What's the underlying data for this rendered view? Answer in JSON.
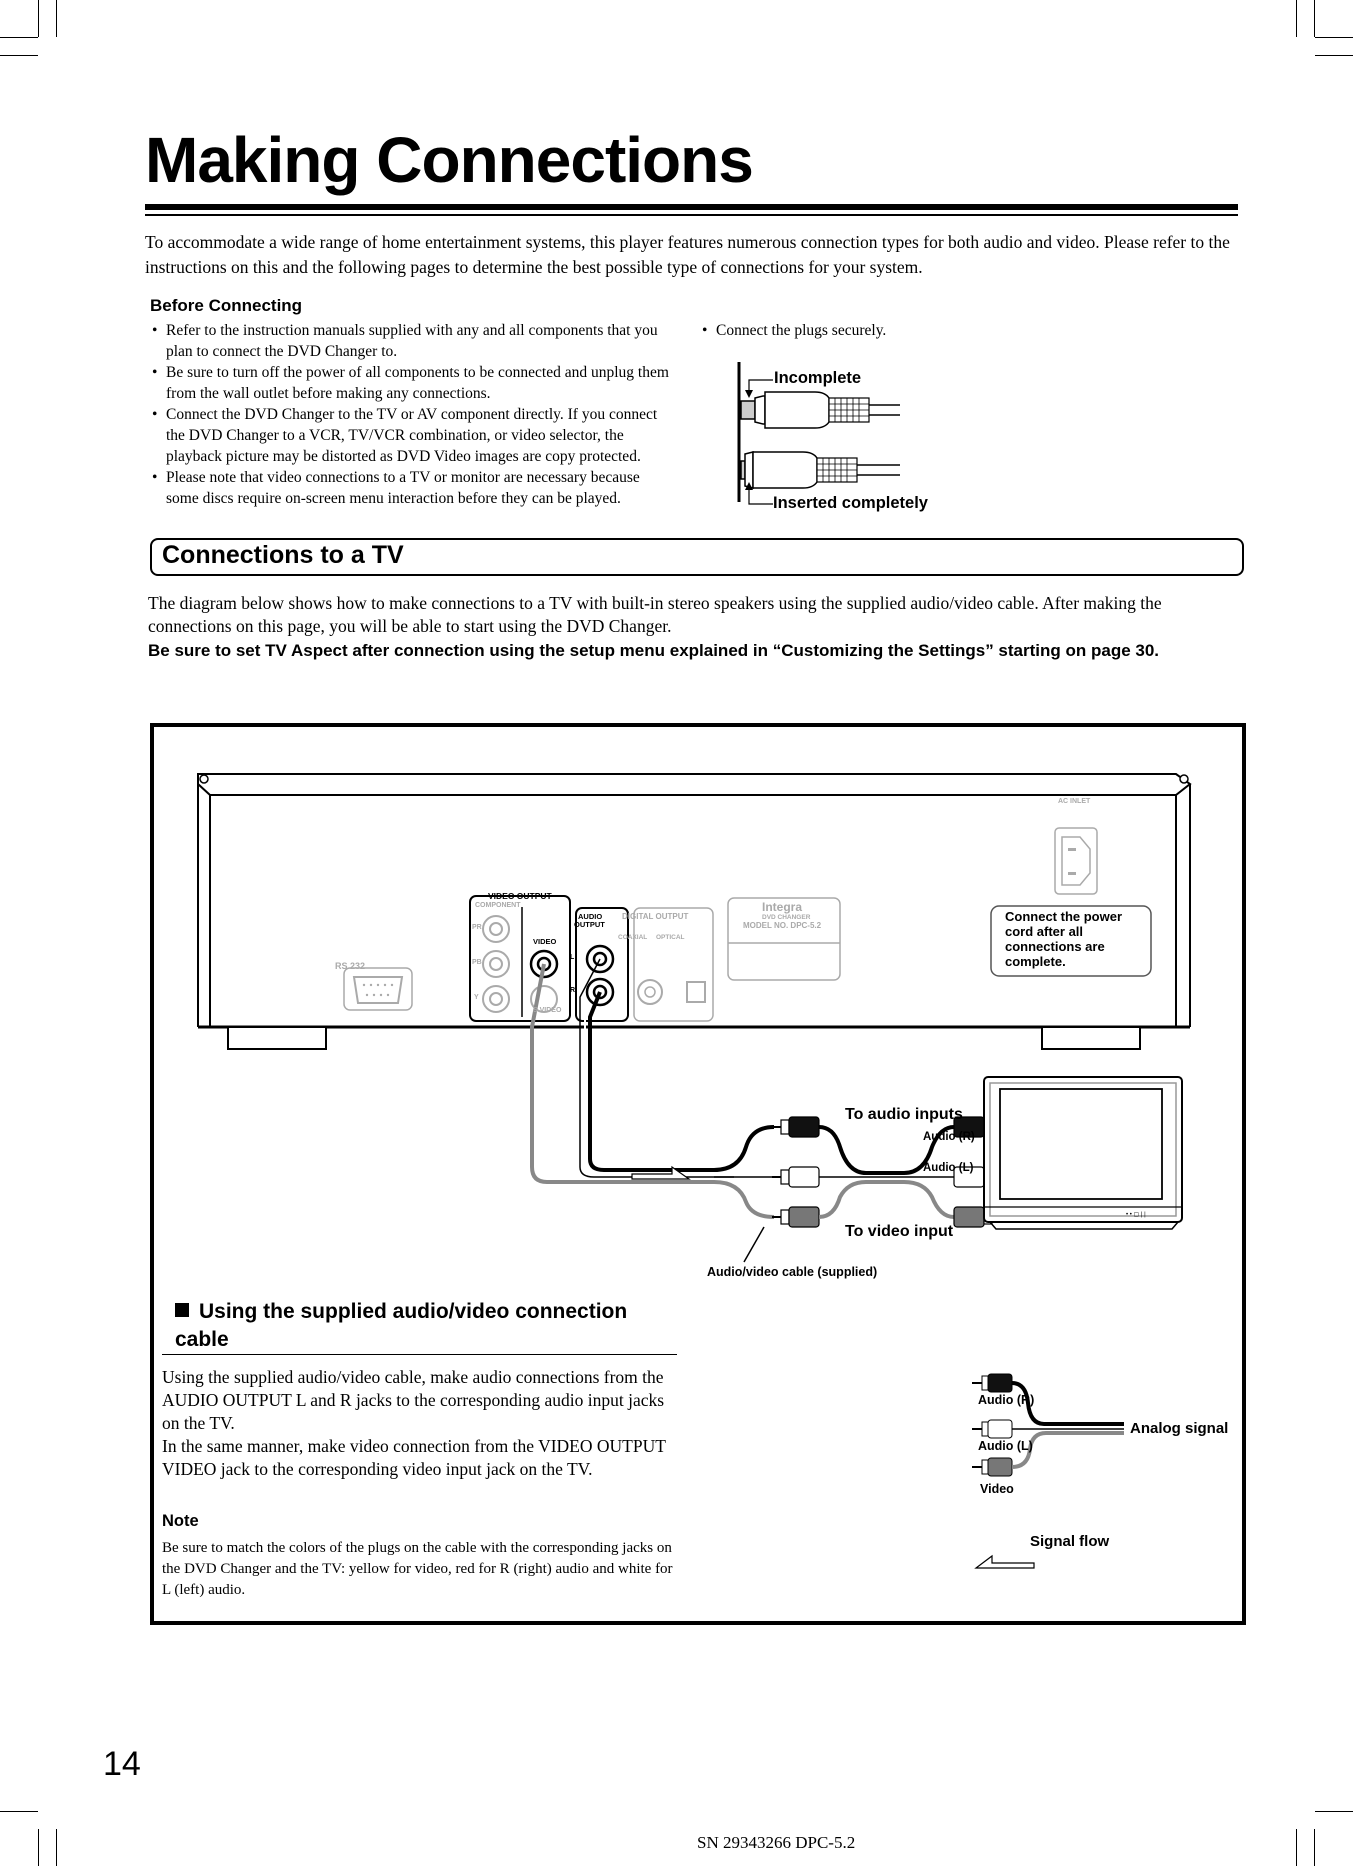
{
  "page": {
    "title": "Making Connections",
    "intro": "To accommodate a wide range of home entertainment systems, this player features numerous connection types for both audio and video. Please refer to the instructions on this and the following pages to determine the best possible type of connections for your system.",
    "page_number": "14",
    "footer": "SN 29343266 DPC-5.2"
  },
  "before_connecting": {
    "heading": "Before Connecting",
    "items": [
      "Refer to the instruction manuals supplied with any and all components that you plan to connect the DVD Changer to.",
      "Be sure to turn off the power of all components to be connected and unplug them from the wall outlet before making any connections.",
      "Connect the DVD Changer to the TV or AV component directly. If you connect the DVD Changer to a VCR, TV/VCR combination, or video selector, the playback picture may be distorted as DVD Video images are copy protected.",
      "Please note that video connections to a TV or monitor are necessary because some discs require on-screen menu interaction before they can be played."
    ],
    "right_item": "Connect the plugs securely.",
    "plug_labels": {
      "incomplete": "Incomplete",
      "complete": "Inserted completely"
    }
  },
  "connections_tv": {
    "heading": "Connections to a TV",
    "text": "The diagram below shows how to make connections to a TV with built-in stereo speakers using the supplied audio/video cable. After making the connections on this page, you will be able to start using the DVD Changer.",
    "bold_text": "Be sure to set TV Aspect after connection using the setup menu explained in “Customizing the Settings” starting on page 30."
  },
  "diagram": {
    "panel": {
      "rs232": "RS 232",
      "video_output": "VIDEO OUTPUT",
      "component": "COMPONENT",
      "pr": "PR",
      "pb": "PB",
      "y": "Y",
      "video": "VIDEO",
      "s_video": "S VIDEO",
      "audio_output_1": "AUDIO",
      "audio_output_2": "OUTPUT",
      "l": "L",
      "r": "R",
      "digital_output": "DIGITAL OUTPUT",
      "coaxial": "COAXIAL",
      "optical": "OPTICAL",
      "brand": "Integra",
      "product": "DVD CHANGER",
      "model": "MODEL NO. DPC-5.2",
      "ac_inlet": "AC INLET",
      "power_note": "Connect the power cord after all connections are complete."
    },
    "labels": {
      "to_audio_inputs": "To audio inputs",
      "audio_r": "Audio (R)",
      "audio_l": "Audio (L)",
      "to_video_input": "To video input",
      "cable": "Audio/video cable (supplied)"
    },
    "legend": {
      "audio_r": "Audio (R)",
      "audio_l": "Audio (L)",
      "video": "Video",
      "analog_signal": "Analog signal",
      "signal_flow": "Signal flow"
    }
  },
  "using_cable": {
    "heading": "Using the supplied audio/video connection cable",
    "text_1": "Using the supplied audio/video cable, make audio connections from the AUDIO OUTPUT L and R jacks to the corresponding audio input jacks on the TV.",
    "text_2": "In the same manner, make video connection from the VIDEO OUTPUT VIDEO jack to the corresponding video input jack on the TV.",
    "note_heading": "Note",
    "note_text": "Be sure to match the colors of the plugs on the cable with the corresponding jacks on the DVD Changer and the TV: yellow for video, red for R (right) audio and white for L (left) audio."
  }
}
